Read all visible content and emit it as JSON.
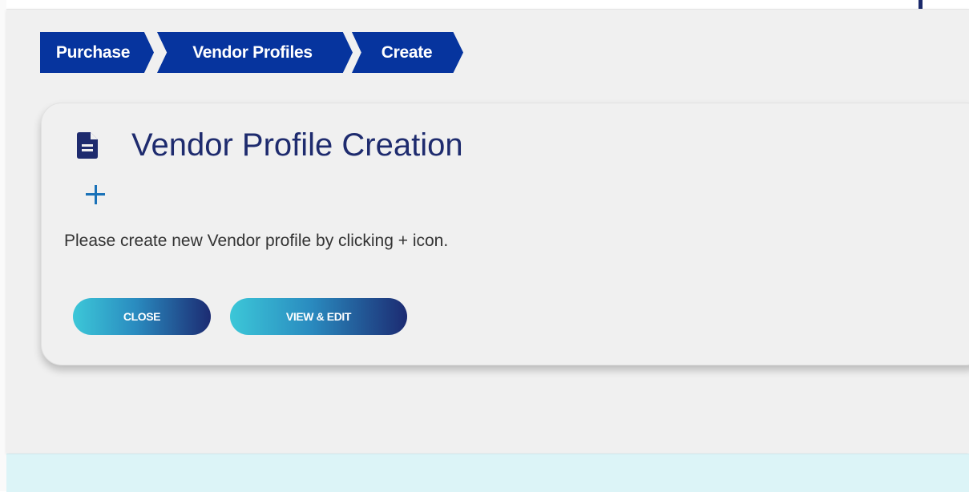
{
  "breadcrumb": {
    "items": [
      "Purchase",
      "Vendor Profiles",
      "Create"
    ]
  },
  "card": {
    "title": "Vendor Profile Creation",
    "hint": "Please create new Vendor profile by clicking + icon.",
    "icons": {
      "title_icon": "document-icon",
      "add_icon": "plus-icon"
    }
  },
  "actions": {
    "close_label": "CLOSE",
    "view_edit_label": "VIEW & EDIT"
  },
  "colors": {
    "breadcrumb_bg": "#06349e",
    "title_color": "#1e2b6e",
    "plus_color": "#1a72b8",
    "button_gradient_start": "#3cc7d8",
    "button_gradient_end": "#1c2b72",
    "page_bg": "#f0f0f0",
    "footer_bg": "#dcf4f7"
  }
}
